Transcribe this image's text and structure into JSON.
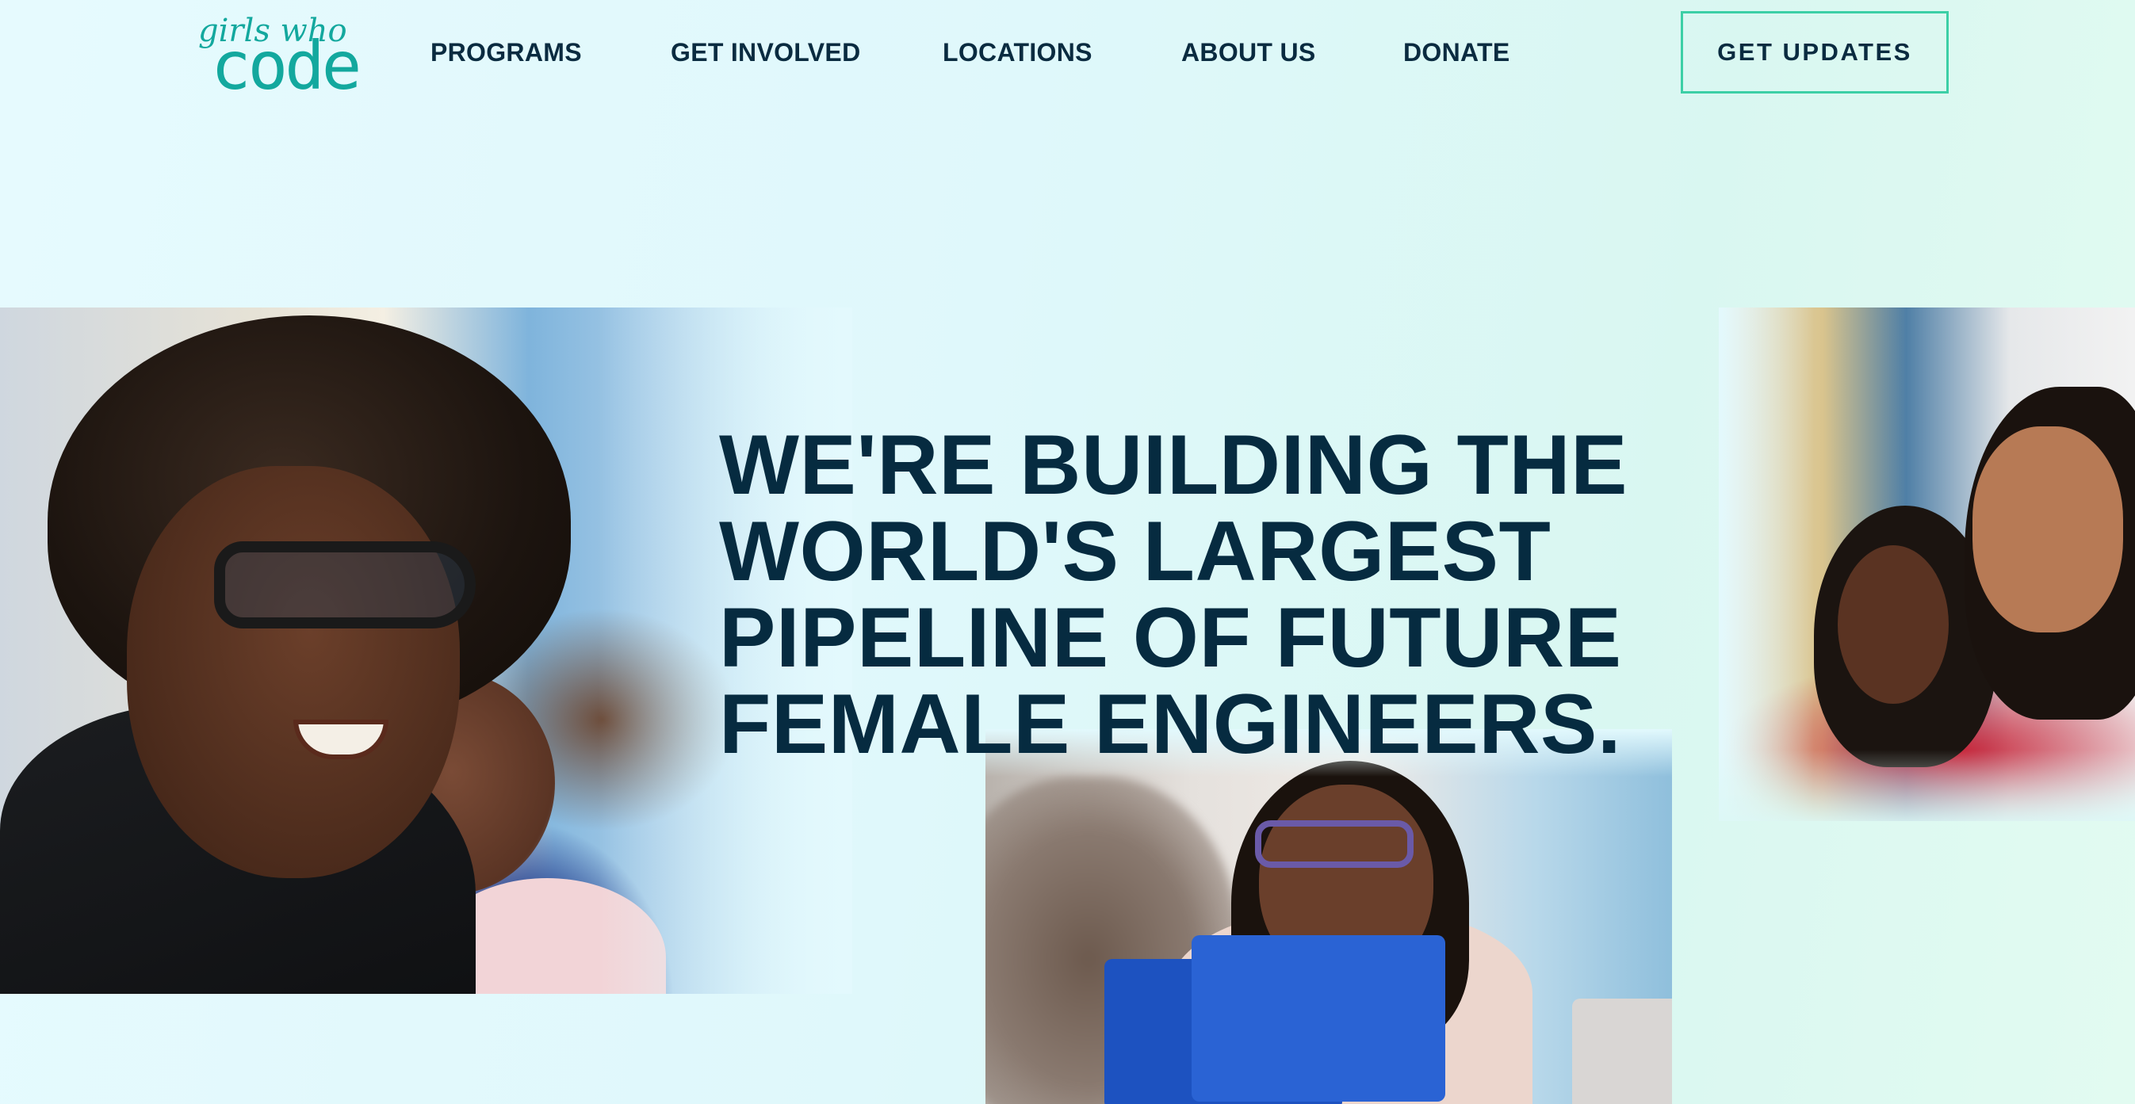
{
  "brand": {
    "logo_line1": "girls who",
    "logo_line2": "code",
    "logo_color": "#13a89e"
  },
  "nav": {
    "items": [
      {
        "label": "PROGRAMS"
      },
      {
        "label": "GET INVOLVED"
      },
      {
        "label": "LOCATIONS"
      },
      {
        "label": "ABOUT US"
      },
      {
        "label": "DONATE"
      }
    ],
    "cta_label": "GET  UPDATES",
    "cta_border_color": "#3ccfa6"
  },
  "hero": {
    "headline_lines": [
      "WE'RE BUILDING THE",
      "WORLD'S LARGEST",
      "PIPELINE OF FUTURE",
      "FEMALE ENGINEERS."
    ],
    "headline_color": "#062b40",
    "photos": [
      {
        "name": "hero-photo-left",
        "description_icon": "photo"
      },
      {
        "name": "hero-photo-right",
        "description_icon": "photo"
      },
      {
        "name": "hero-photo-bottom",
        "description_icon": "photo"
      }
    ]
  }
}
